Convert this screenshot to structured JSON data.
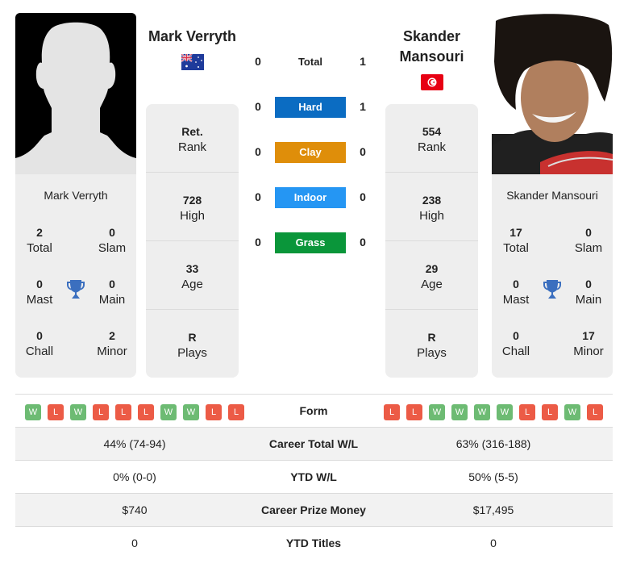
{
  "player1": {
    "name": "Mark Verryth",
    "country_flag": "australia-flag",
    "photo": "silhouette-placeholder",
    "rank_value": "Ret.",
    "rank_label": "Rank",
    "high_value": "728",
    "high_label": "High",
    "age_value": "33",
    "age_label": "Age",
    "plays_value": "R",
    "plays_label": "Plays",
    "titles": {
      "total": "2",
      "total_label": "Total",
      "slam": "0",
      "slam_label": "Slam",
      "mast": "0",
      "mast_label": "Mast",
      "main": "0",
      "main_label": "Main",
      "chall": "0",
      "chall_label": "Chall",
      "minor": "2",
      "minor_label": "Minor"
    },
    "form": [
      "W",
      "L",
      "W",
      "L",
      "L",
      "L",
      "W",
      "W",
      "L",
      "L"
    ],
    "career_wl": "44% (74-94)",
    "ytd_wl": "0% (0-0)",
    "prize_money": "$740",
    "ytd_titles": "0"
  },
  "player2": {
    "name_line1": "Skander",
    "name_line2": "Mansouri",
    "name": "Skander Mansouri",
    "country_flag": "tunisia-flag",
    "photo": "player-photo",
    "rank_value": "554",
    "rank_label": "Rank",
    "high_value": "238",
    "high_label": "High",
    "age_value": "29",
    "age_label": "Age",
    "plays_value": "R",
    "plays_label": "Plays",
    "titles": {
      "total": "17",
      "total_label": "Total",
      "slam": "0",
      "slam_label": "Slam",
      "mast": "0",
      "mast_label": "Mast",
      "main": "0",
      "main_label": "Main",
      "chall": "0",
      "chall_label": "Chall",
      "minor": "17",
      "minor_label": "Minor"
    },
    "form": [
      "L",
      "L",
      "W",
      "W",
      "W",
      "W",
      "L",
      "L",
      "W",
      "L"
    ],
    "career_wl": "63% (316-188)",
    "ytd_wl": "50% (5-5)",
    "prize_money": "$17,495",
    "ytd_titles": "0"
  },
  "h2h": [
    {
      "label": "Total",
      "left": "0",
      "right": "1",
      "color": ""
    },
    {
      "label": "Hard",
      "left": "0",
      "right": "1",
      "color": "#0b6cc2"
    },
    {
      "label": "Clay",
      "left": "0",
      "right": "0",
      "color": "#df8e0a"
    },
    {
      "label": "Indoor",
      "left": "0",
      "right": "0",
      "color": "#2596f3"
    },
    {
      "label": "Grass",
      "left": "0",
      "right": "0",
      "color": "#0a963a"
    }
  ],
  "table": {
    "form_label": "Form",
    "career_wl_label": "Career Total W/L",
    "ytd_wl_label": "YTD W/L",
    "prize_money_label": "Career Prize Money",
    "ytd_titles_label": "YTD Titles"
  },
  "colors": {
    "win": "#6dbb73",
    "loss": "#ec5b46",
    "trophy": "#3b6fbf",
    "card_bg": "#eeeeee"
  }
}
